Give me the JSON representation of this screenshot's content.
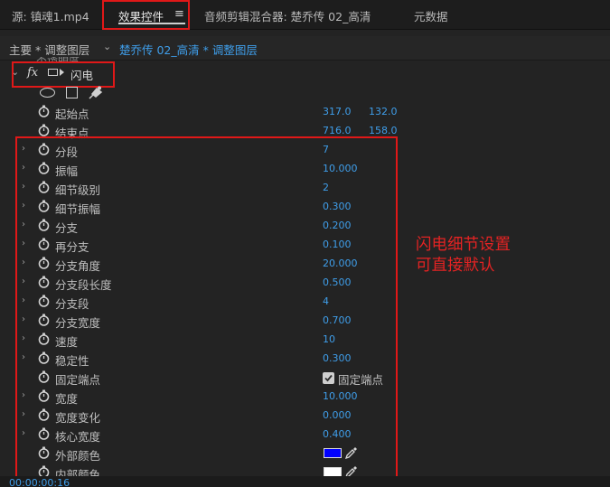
{
  "tabs": [
    {
      "label": "源: 镇魂1.mp4",
      "active": false
    },
    {
      "label": "效果控件",
      "active": true
    },
    {
      "label": "音频剪辑混合器: 楚乔传 02_高清",
      "active": false
    },
    {
      "label": "元数据",
      "active": false
    }
  ],
  "clip_bar": {
    "master": "主要 * 调整图层",
    "clip": "楚乔传 02_高清 * 调整图层"
  },
  "effect": {
    "badge": "fx",
    "name": "闪电"
  },
  "properties": [
    {
      "label": "起始点",
      "value1": "317.0",
      "value2": "132.0",
      "expandable": false
    },
    {
      "label": "结束点",
      "value1": "716.0",
      "value2": "158.0",
      "expandable": false
    },
    {
      "label": "分段",
      "value1": "7",
      "expandable": true
    },
    {
      "label": "振幅",
      "value1": "10.000",
      "expandable": true
    },
    {
      "label": "细节级别",
      "value1": "2",
      "expandable": true
    },
    {
      "label": "细节振幅",
      "value1": "0.300",
      "expandable": true
    },
    {
      "label": "分支",
      "value1": "0.200",
      "expandable": true
    },
    {
      "label": "再分支",
      "value1": "0.100",
      "expandable": true
    },
    {
      "label": "分支角度",
      "value1": "20.000",
      "expandable": true
    },
    {
      "label": "分支段长度",
      "value1": "0.500",
      "expandable": true
    },
    {
      "label": "分支段",
      "value1": "4",
      "expandable": true
    },
    {
      "label": "分支宽度",
      "value1": "0.700",
      "expandable": true
    },
    {
      "label": "速度",
      "value1": "10",
      "expandable": true
    },
    {
      "label": "稳定性",
      "value1": "0.300",
      "expandable": true
    },
    {
      "label": "固定端点",
      "checkbox": true,
      "checkbox_label": "固定端点",
      "expandable": false
    },
    {
      "label": "宽度",
      "value1": "10.000",
      "expandable": true
    },
    {
      "label": "宽度变化",
      "value1": "0.000",
      "expandable": true
    },
    {
      "label": "核心宽度",
      "value1": "0.400",
      "expandable": true
    },
    {
      "label": "外部颜色",
      "color": "#0000ff",
      "expandable": false
    },
    {
      "label": "内部颜色",
      "color": "#ffffff",
      "expandable": false
    }
  ],
  "annotation": {
    "line1": "闪电细节设置",
    "line2": "可直接默认"
  },
  "timecode": "00:00:00:16",
  "colors": {
    "accent_blue": "#3f9eea",
    "highlight_red": "#e01818"
  }
}
